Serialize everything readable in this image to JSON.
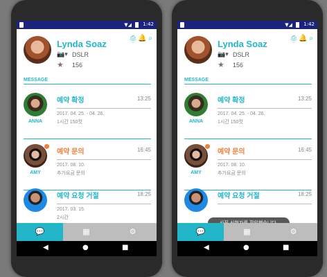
{
  "statusbar": {
    "time": "1:42",
    "signal": "▼◢"
  },
  "profile": {
    "name": "Lynda Soaz",
    "camera": "DSLR",
    "rating_count": "156"
  },
  "section": {
    "message_label": "MESSAGE"
  },
  "messages": [
    {
      "title": "예약 확정",
      "time": "13:25",
      "date": "2017. 04. 25. - 04. 26.",
      "detail": "1시간 150컷",
      "who": "ANNA",
      "title_color": "#22b6c8"
    },
    {
      "title": "예약 문의",
      "time": "16:45",
      "date": "2017. 08. 10.",
      "detail": "추가요금 문의",
      "who": "AMY",
      "title_color": "#f07f3c"
    },
    {
      "title": "예약 요청 거절",
      "time": "18:25",
      "date": "2017. 03. 15.",
      "detail": "2시간",
      "who": "",
      "title_color": "#22b6c8"
    }
  ],
  "toast": {
    "text": "사진 신청자를 확인했습니다."
  },
  "colors": {
    "accent": "#22b6c8",
    "orange": "#f07f3c",
    "statusbar": "#1a237e"
  },
  "icons": {
    "tabs": [
      "chat-icon",
      "calendar-icon",
      "gear-icon"
    ],
    "nav": [
      "back-icon",
      "home-icon",
      "recent-apps-icon"
    ],
    "tools": [
      "printer-icon",
      "bell-icon",
      "search-icon"
    ]
  }
}
